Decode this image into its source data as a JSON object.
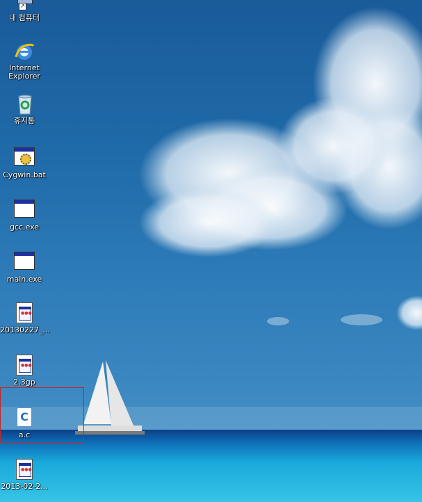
{
  "desktop": {
    "icons": [
      {
        "label": "내 컴퓨터",
        "icon": "my-computer-icon"
      },
      {
        "label": "Internet Explorer",
        "icon": "internet-explorer-icon"
      },
      {
        "label": "휴지통",
        "icon": "recycle-bin-icon"
      },
      {
        "label": "Cygwin.bat",
        "icon": "batch-file-icon"
      },
      {
        "label": "gcc.exe",
        "icon": "application-icon"
      },
      {
        "label": "main.exe",
        "icon": "application-icon"
      },
      {
        "label": "20130227_...",
        "icon": "document-icon"
      },
      {
        "label": "2.3gp",
        "icon": "document-icon"
      },
      {
        "label": "a.c",
        "icon": "c-source-file-icon"
      },
      {
        "label": "2013-02-2...",
        "icon": "document-icon"
      }
    ],
    "ie_label_line1": "Internet",
    "ie_label_line2": "Explorer",
    "c_glyph": "C",
    "selection_color": "#c0282a"
  }
}
